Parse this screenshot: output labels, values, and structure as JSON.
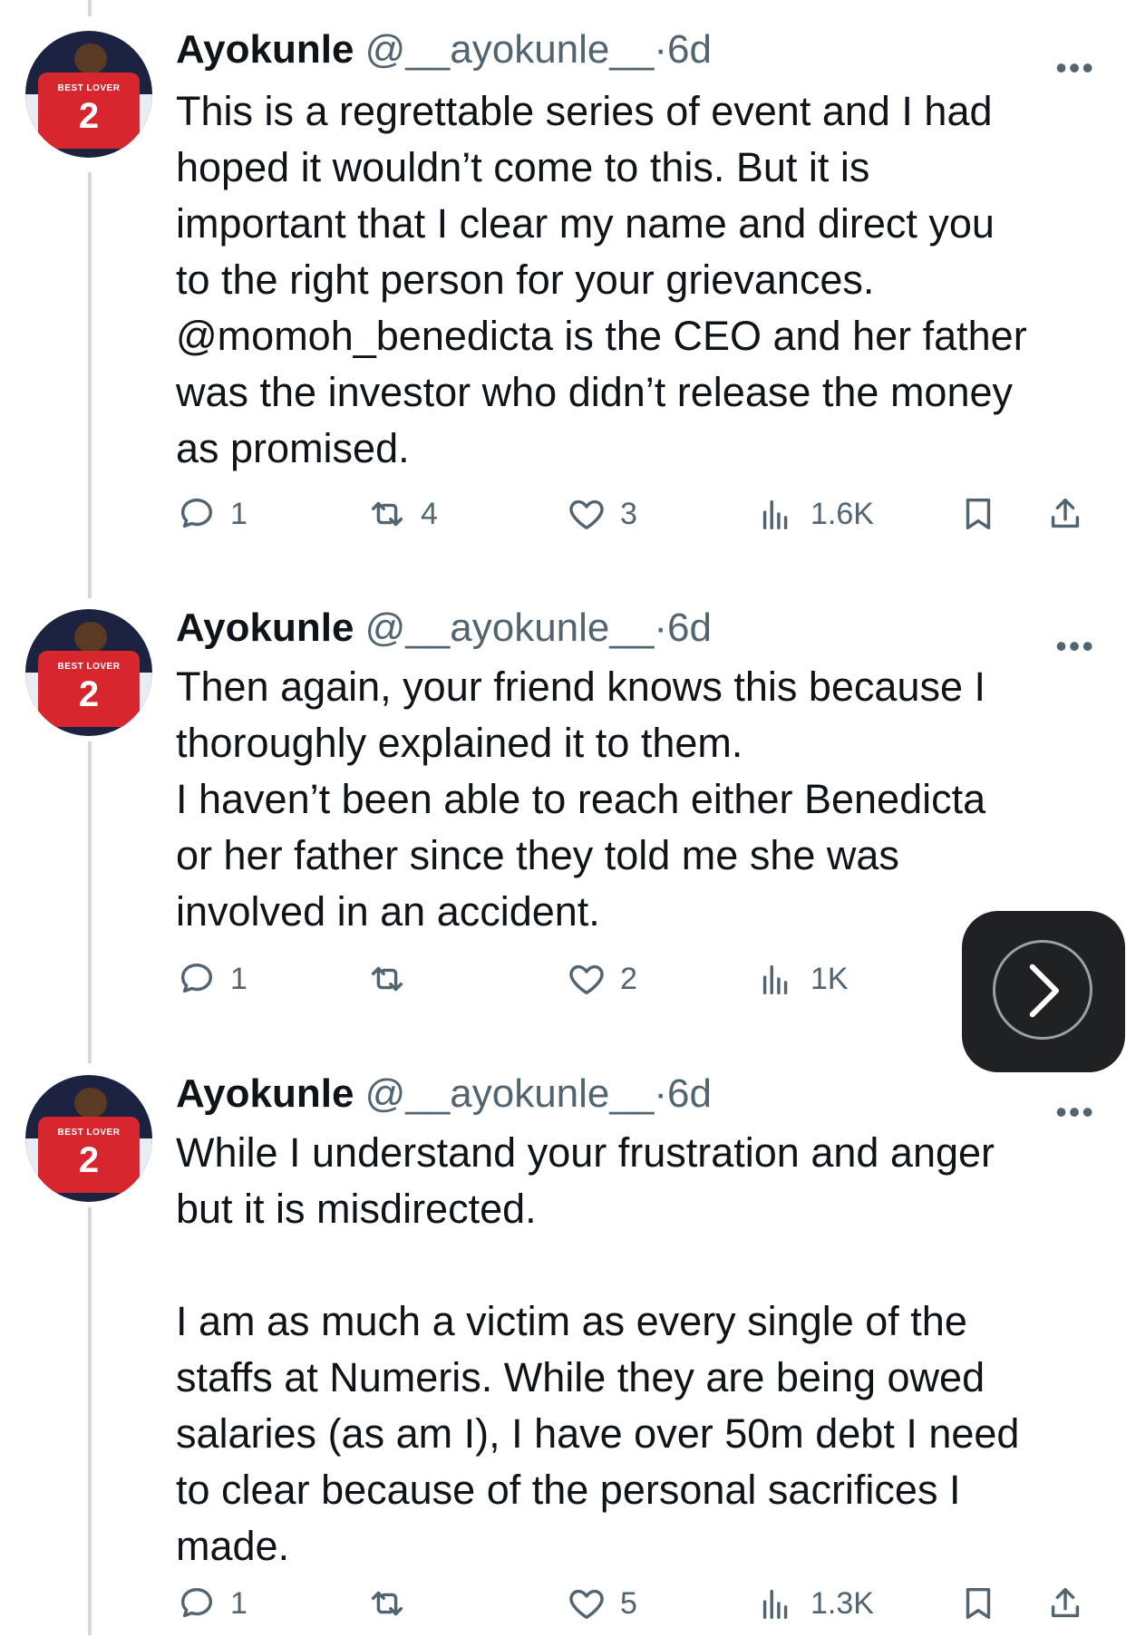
{
  "tweets": [
    {
      "author": "Ayokunle",
      "handle": "@__ayokunle__",
      "dot": "·",
      "time": "6d",
      "more": "•••",
      "text": "This is a regrettable series of event and I had\nhoped it wouldn’t come to this. But it is\nimportant that I clear my name and direct you\nto the right person for your grievances.\n@momoh_benedicta is the CEO and her father\nwas the investor who didn’t release the money\nas promised.",
      "replies": "1",
      "retweets": "4",
      "likes": "3",
      "views": "1.6K"
    },
    {
      "author": "Ayokunle",
      "handle": "@__ayokunle__",
      "dot": "·",
      "time": "6d",
      "more": "•••",
      "text": "Then again, your friend knows this because I\nthoroughly explained it to them.\nI haven’t been able to reach either Benedicta\nor her father since they told me she was\ninvolved in an accident.",
      "replies": "1",
      "retweets": "",
      "likes": "2",
      "views": "1K"
    },
    {
      "author": "Ayokunle",
      "handle": "@__ayokunle__",
      "dot": "·",
      "time": "6d",
      "more": "•••",
      "text": "While I understand your frustration and anger\nbut it is misdirected.\n\nI am as much a victim as every single of the\nstaffs at Numeris. While they are being owed\nsalaries (as am I), I have over 50m debt I need\nto clear because of the personal sacrifices I\nmade.",
      "replies": "1",
      "retweets": "",
      "likes": "5",
      "views": "1.3K"
    }
  ],
  "avatar": {
    "shirt_text": "BEST LOVER",
    "shirt_number": "2"
  },
  "icons": {
    "reply": "reply-icon",
    "retweet": "retweet-icon",
    "like": "heart-icon",
    "views": "views-icon",
    "bookmark": "bookmark-icon",
    "share": "share-icon",
    "next": "chevron-right-icon"
  },
  "colors": {
    "text": "#0f1419",
    "secondary": "#536471",
    "thread_line": "#cfd9de",
    "overlay": "#202124"
  }
}
